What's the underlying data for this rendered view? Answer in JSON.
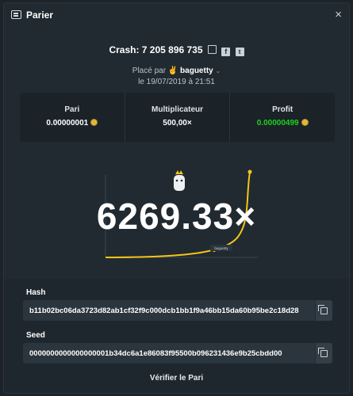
{
  "header": {
    "title": "Parier",
    "close": "×",
    "icon": "bet-icon"
  },
  "crash": {
    "label": "Crash: 7 205 896 735",
    "icons": [
      "copy-icon",
      "facebook-icon",
      "twitter-icon"
    ]
  },
  "placed": {
    "prefix": "Placé par",
    "emoji": "✌",
    "user": "baguetty",
    "chevron": "⌄"
  },
  "date": "le 19/07/2019 à 21:51",
  "stats": {
    "pari": {
      "label": "Pari",
      "value": "0.00000001"
    },
    "multiplicateur": {
      "label": "Multiplicateur",
      "value": "500,00×"
    },
    "profit": {
      "label": "Profit",
      "value": "0.00000499",
      "color": "#1fd11f"
    }
  },
  "multiplier_display": "6269.33×",
  "chart_point_label": "baguetty",
  "hash": {
    "label": "Hash",
    "value": "b11b02bc06da3723d82ab1cf32f9c000dcb1bb1f9a46bb15da60b95be2c18d28"
  },
  "seed": {
    "label": "Seed",
    "value": "0000000000000000001b34dc6a1e86083f95500b096231436e9b25cbdd00"
  },
  "verify_label": "Vérifier le Pari",
  "colors": {
    "accent": "#f5c518",
    "profit": "#1fd11f",
    "coin": "#e0b73a"
  }
}
